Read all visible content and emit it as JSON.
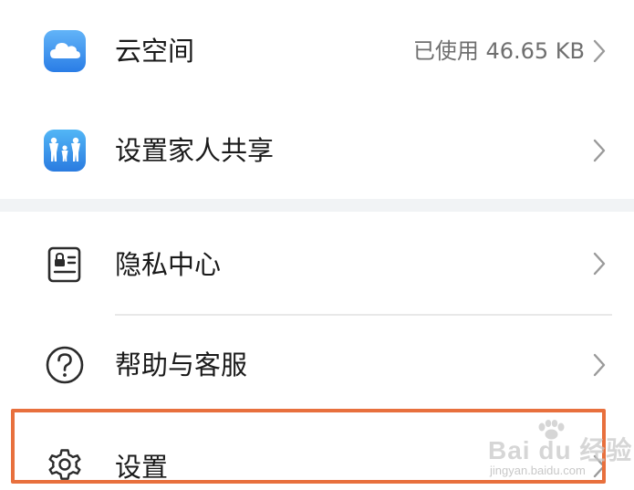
{
  "items": [
    {
      "label": "云空间",
      "value": "已使用 46.65 KB",
      "icon": "cloud-icon"
    },
    {
      "label": "设置家人共享",
      "value": "",
      "icon": "family-share-icon"
    },
    {
      "label": "隐私中心",
      "value": "",
      "icon": "privacy-center-icon"
    },
    {
      "label": "帮助与客服",
      "value": "",
      "icon": "help-icon"
    },
    {
      "label": "设置",
      "value": "",
      "icon": "gear-icon"
    }
  ],
  "colors": {
    "cloud_icon_top": "#5fb0f7",
    "cloud_icon_bottom": "#2b7fe6",
    "family_icon_top": "#4fb3f5",
    "family_icon_bottom": "#2a7de0",
    "highlight": "#e8703d",
    "text": "#1a1a1a",
    "secondary_text": "#6f6f6f"
  },
  "watermark": {
    "brand": "Bai du 经验",
    "url": "jingyan.baidu.com"
  }
}
